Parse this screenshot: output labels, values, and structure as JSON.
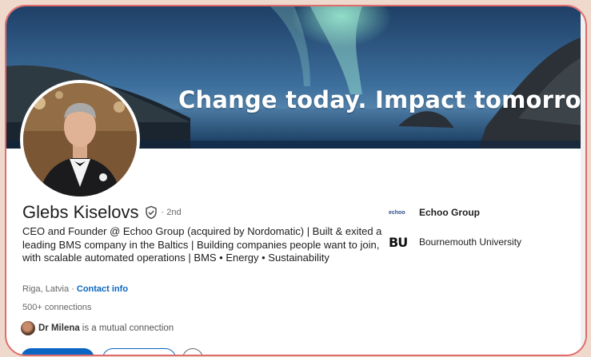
{
  "banner": {
    "tagline": "Change today. Impact tomorrow."
  },
  "profile": {
    "name": "Glebs Kiselovs",
    "degree": "· 2nd",
    "headline": "CEO and Founder @ Echoo Group (acquired by Nordomatic) | Built & exited a leading BMS company in the Baltics | Building companies people want to join, with scalable automated operations | BMS • Energy • Sustainability",
    "location": "Riga, Latvia",
    "location_separator": " · ",
    "contact_info": "Contact info",
    "connections": "500+ connections",
    "mutual_name": "Dr Milena",
    "mutual_suffix": "is a mutual connection"
  },
  "organizations": [
    {
      "logo_text": "echoo",
      "name": "Echoo Group"
    },
    {
      "logo_text": "BU",
      "name": "Bournemouth University"
    }
  ],
  "colors": {
    "accent": "#0a66c2",
    "frame_border": "#e06c6c",
    "page_background": "#efd9cc"
  },
  "icons": {
    "verification": "verified-shield-icon",
    "more": "more-icon"
  }
}
